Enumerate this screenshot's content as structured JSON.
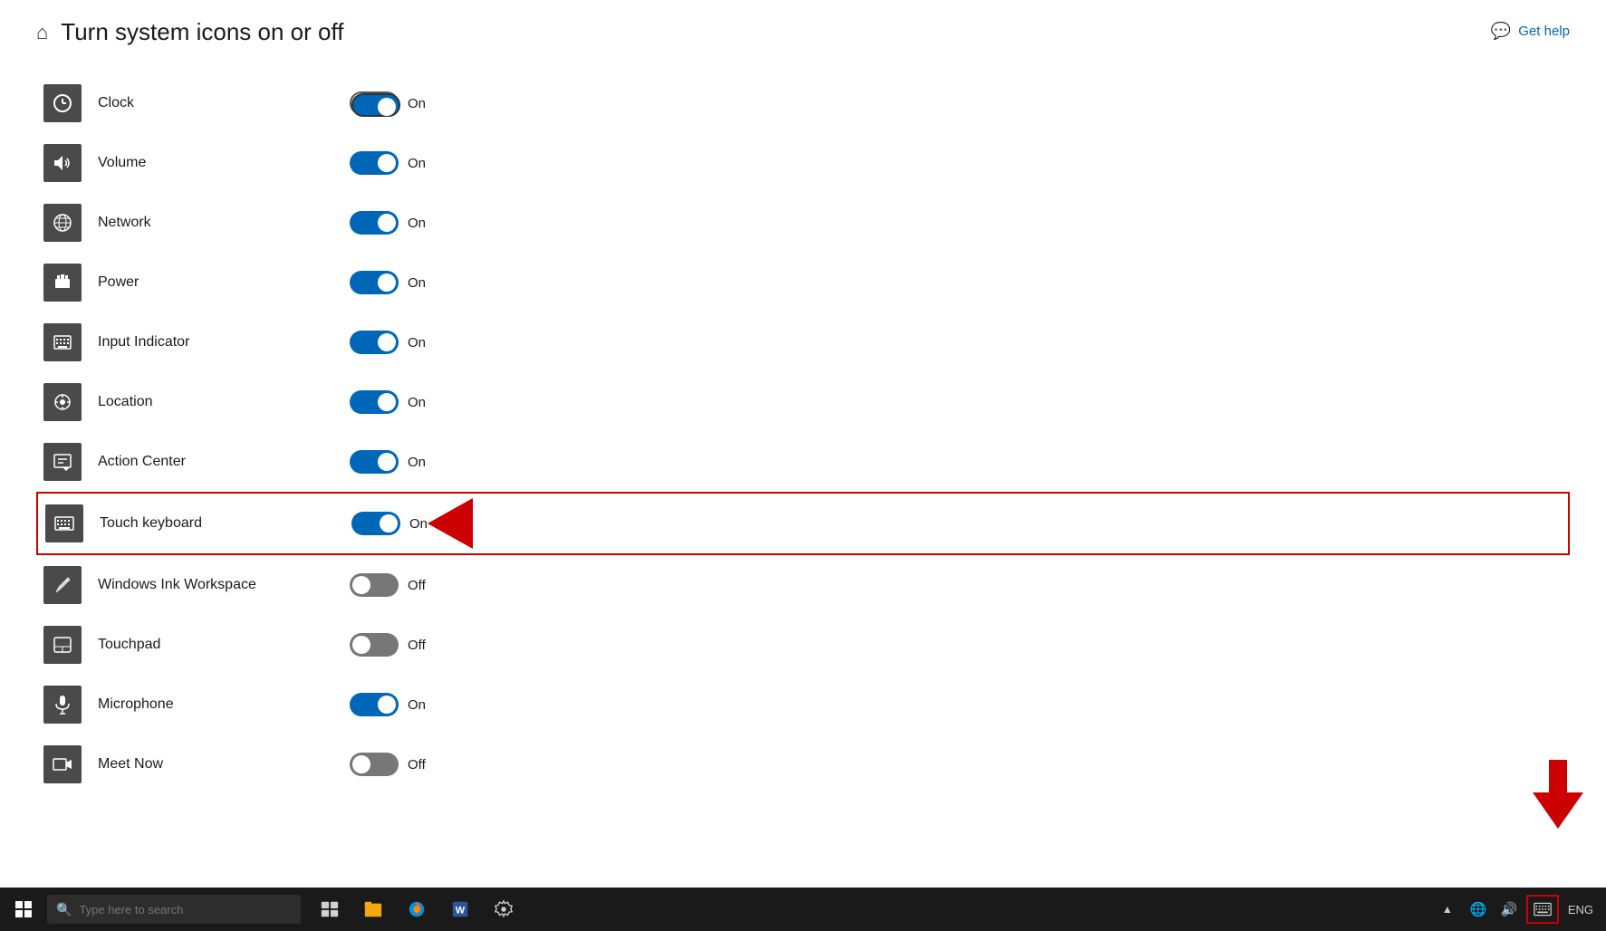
{
  "page": {
    "title": "Turn system icons on or off",
    "get_help_label": "Get help"
  },
  "settings": [
    {
      "id": "clock",
      "label": "Clock",
      "state": "on",
      "highlighted_toggle": true
    },
    {
      "id": "volume",
      "label": "Volume",
      "state": "on",
      "highlighted_toggle": false
    },
    {
      "id": "network",
      "label": "Network",
      "state": "on",
      "highlighted_toggle": false
    },
    {
      "id": "power",
      "label": "Power",
      "state": "on",
      "highlighted_toggle": false
    },
    {
      "id": "input-indicator",
      "label": "Input Indicator",
      "state": "on",
      "highlighted_toggle": false
    },
    {
      "id": "location",
      "label": "Location",
      "state": "on",
      "highlighted_toggle": false
    },
    {
      "id": "action-center",
      "label": "Action Center",
      "state": "on",
      "highlighted_toggle": false
    },
    {
      "id": "touch-keyboard",
      "label": "Touch keyboard",
      "state": "on",
      "highlighted_toggle": false,
      "highlighted_row": true
    },
    {
      "id": "windows-ink",
      "label": "Windows Ink Workspace",
      "state": "off",
      "highlighted_toggle": false
    },
    {
      "id": "touchpad",
      "label": "Touchpad",
      "state": "off",
      "highlighted_toggle": false
    },
    {
      "id": "microphone",
      "label": "Microphone",
      "state": "on",
      "highlighted_toggle": false
    },
    {
      "id": "meet-now",
      "label": "Meet Now",
      "state": "off",
      "highlighted_toggle": false
    }
  ],
  "taskbar": {
    "search_placeholder": "Type here to search",
    "lang": "ENG"
  }
}
